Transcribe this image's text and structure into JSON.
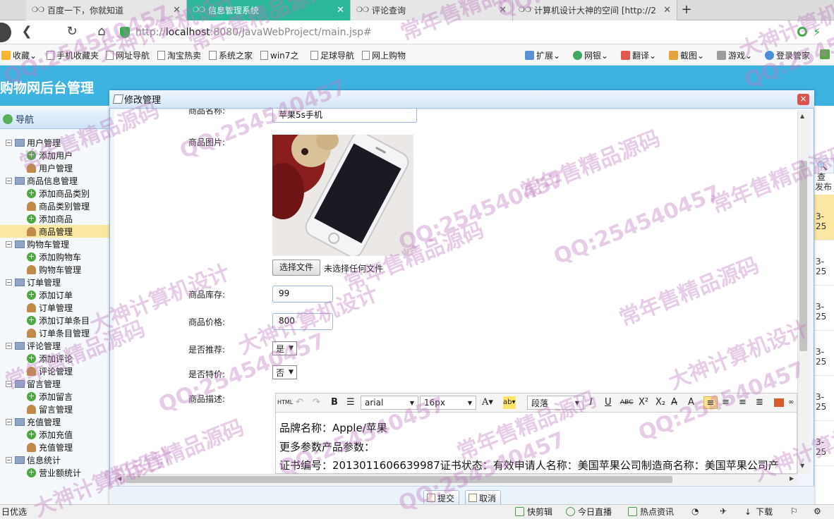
{
  "browser": {
    "tabs": [
      {
        "label": "百度一下，你就知道",
        "active": false
      },
      {
        "label": "信息管理系统",
        "active": true
      },
      {
        "label": "评论查询",
        "active": false
      },
      {
        "label": "计算机设计大神的空间 [http://2",
        "active": false
      }
    ],
    "url_prefix": "http://",
    "url_host": "localhost",
    "url_rest": ":8080/JavaWebProject/main.jsp#",
    "bookmarks": [
      "收藏",
      "手机收藏夹",
      "网址导航",
      "淘宝热卖",
      "系统之家",
      "win7之",
      "足球导航",
      "网上购物"
    ],
    "bookmark_tools": [
      "扩展",
      "网银",
      "翻译",
      "截图",
      "游戏",
      "登录管家"
    ]
  },
  "app": {
    "title": "购物网后台管理",
    "nav_title": "导航"
  },
  "sidebar": {
    "items": [
      {
        "label": "用户管理",
        "type": "group"
      },
      {
        "label": "添加用户",
        "type": "add"
      },
      {
        "label": "用户管理",
        "type": "manage"
      },
      {
        "label": "商品信息管理",
        "type": "group"
      },
      {
        "label": "添加商品类别",
        "type": "add"
      },
      {
        "label": "商品类别管理",
        "type": "manage"
      },
      {
        "label": "添加商品",
        "type": "add"
      },
      {
        "label": "商品管理",
        "type": "manage",
        "selected": true
      },
      {
        "label": "购物车管理",
        "type": "group"
      },
      {
        "label": "添加购物车",
        "type": "add"
      },
      {
        "label": "购物车管理",
        "type": "manage"
      },
      {
        "label": "订单管理",
        "type": "group"
      },
      {
        "label": "添加订单",
        "type": "add"
      },
      {
        "label": "订单管理",
        "type": "manage"
      },
      {
        "label": "添加订单条目",
        "type": "add"
      },
      {
        "label": "订单条目管理",
        "type": "manage"
      },
      {
        "label": "评论管理",
        "type": "group"
      },
      {
        "label": "添加评论",
        "type": "add"
      },
      {
        "label": "评论管理",
        "type": "manage"
      },
      {
        "label": "留言管理",
        "type": "group"
      },
      {
        "label": "添加留言",
        "type": "add"
      },
      {
        "label": "留言管理",
        "type": "manage"
      },
      {
        "label": "充值管理",
        "type": "group"
      },
      {
        "label": "添加充值",
        "type": "add"
      },
      {
        "label": "充值管理",
        "type": "manage"
      },
      {
        "label": "信息统计",
        "type": "group"
      },
      {
        "label": "营业额统计",
        "type": "add"
      }
    ]
  },
  "background": {
    "search_partial": "查",
    "col_partial": "发布时",
    "row_dates": [
      "3-25",
      "3-25",
      "3-25",
      "3-25",
      "3-25",
      "3-25"
    ]
  },
  "dialog": {
    "title": "修改管理",
    "close_glyph": "×",
    "fields": {
      "name_label": "商品名称:",
      "name_value": "苹果5s手机",
      "image_label": "商品图片:",
      "file_button": "选择文件",
      "file_status": "未选择任何文件",
      "stock_label": "商品库存:",
      "stock_value": "99",
      "price_label": "商品价格:",
      "price_value": "800",
      "recommend_label": "是否推荐:",
      "recommend_value": "是",
      "special_label": "是否特价:",
      "special_value": "否",
      "desc_label": "商品描述:"
    },
    "editor": {
      "html_btn": "HTML",
      "font": "arial",
      "size": "16px",
      "format": "段落",
      "lines": [
        "品牌名称：Apple/苹果",
        "更多参数产品参数：",
        "证书编号：2013011606639987证书状态：有效申请人名称：美国苹果公司制造商名称：美国苹果公司产"
      ]
    },
    "submit_label": "提交",
    "cancel_label": "取消"
  },
  "statusbar": {
    "left": "日优选",
    "items": [
      "快剪辑",
      "今日直播",
      "热点资讯",
      "下载"
    ]
  },
  "watermarks": [
    "QQ:254540457",
    "常年售精品源码",
    "大神计算机设计"
  ]
}
